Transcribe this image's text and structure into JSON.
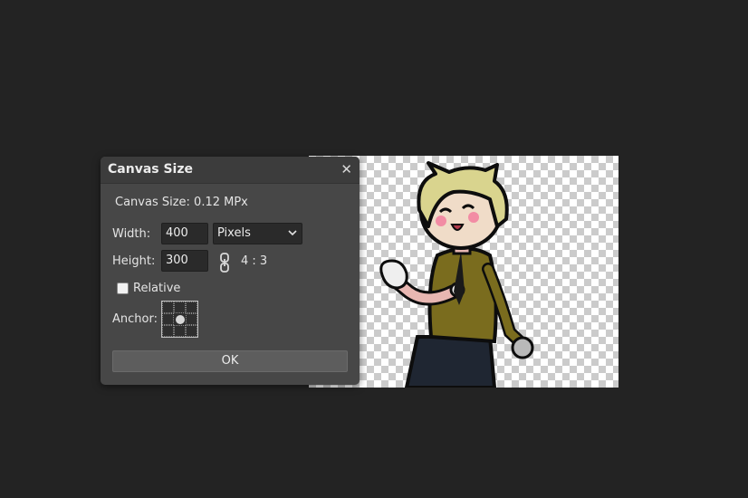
{
  "dialog": {
    "title": "Canvas Size",
    "info": "Canvas Size: 0.12 MPx",
    "width_label": "Width:",
    "width_value": "400",
    "unit_value": "Pixels",
    "height_label": "Height:",
    "height_value": "300",
    "ratio": "4 : 3",
    "relative_label": "Relative",
    "relative_checked": false,
    "anchor_label": "Anchor:",
    "ok_label": "OK"
  },
  "icons": {
    "close": "close-icon",
    "chevron": "chevron-down-icon",
    "link": "chain-link-icon"
  },
  "colors": {
    "background": "#232323",
    "dialog": "#474747",
    "titlebar": "#3c3c3c",
    "field": "#2a2a2a",
    "button": "#5d5d5d"
  }
}
